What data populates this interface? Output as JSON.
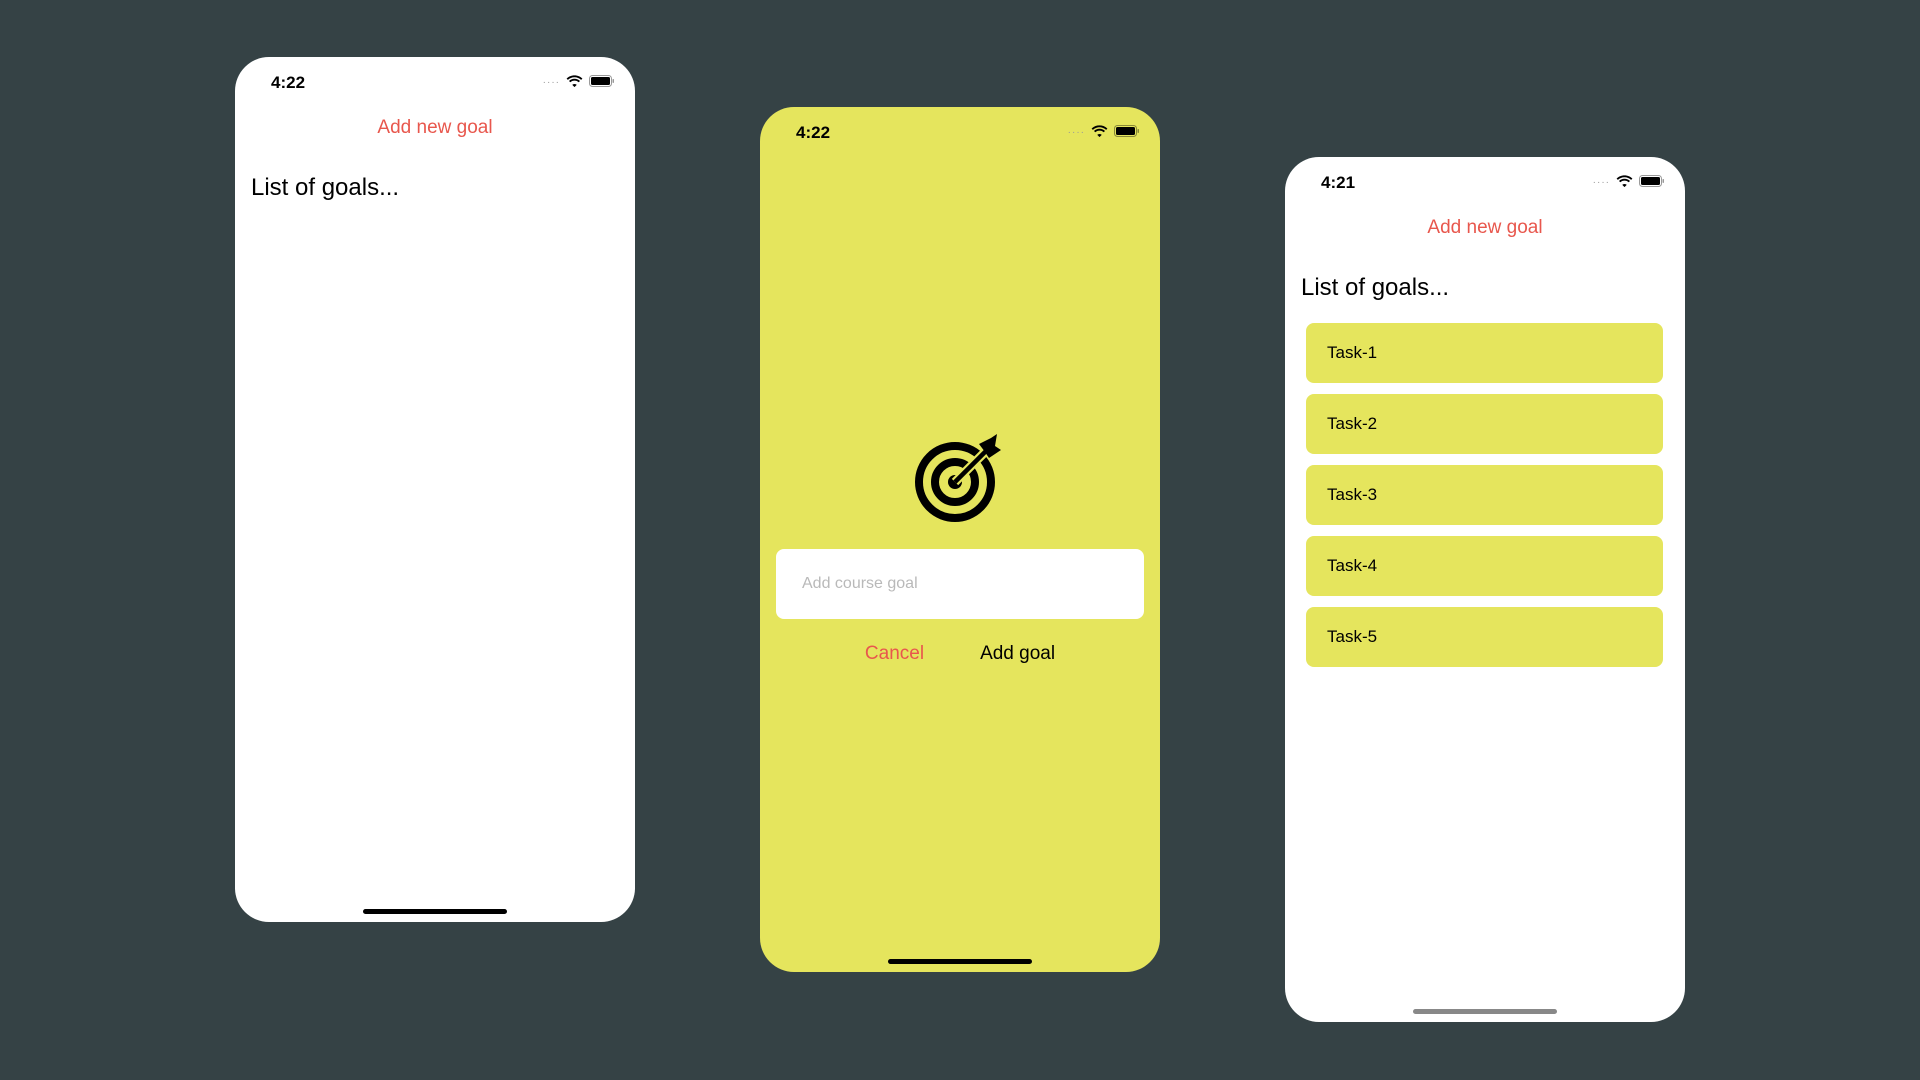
{
  "colors": {
    "background": "#354245",
    "accent": "#e8574d",
    "goal_item": "#e5e55d",
    "modal_background": "#e5e55d"
  },
  "screens": [
    {
      "status_time": "4:22",
      "add_new_goal_label": "Add new goal",
      "list_title": "List of goals..."
    },
    {
      "status_time": "4:22",
      "icon": "target-icon",
      "input_placeholder": "Add course goal",
      "input_value": "",
      "cancel_label": "Cancel",
      "add_goal_label": "Add goal"
    },
    {
      "status_time": "4:21",
      "add_new_goal_label": "Add new goal",
      "list_title": "List of goals...",
      "goals": [
        "Task-1",
        "Task-2",
        "Task-3",
        "Task-4",
        "Task-5"
      ]
    }
  ]
}
